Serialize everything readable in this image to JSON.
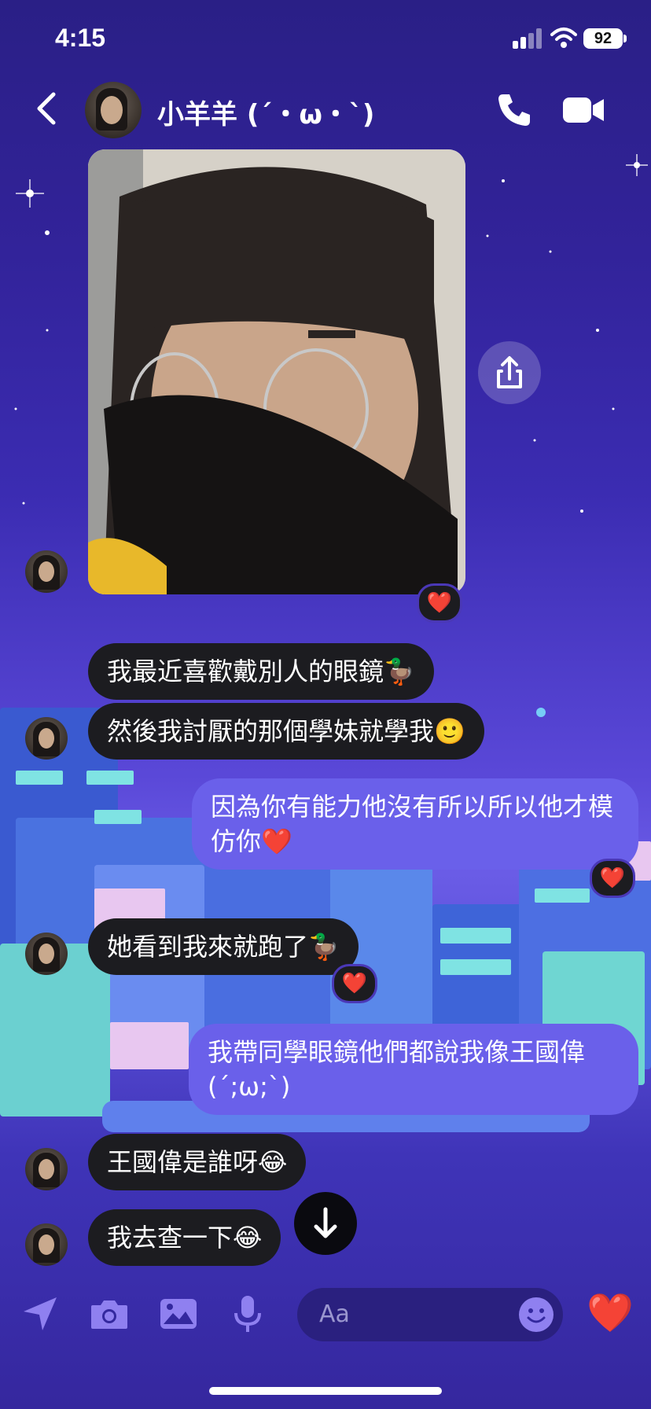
{
  "status_bar": {
    "time": "4:15",
    "battery": "92"
  },
  "header": {
    "contact_name": "小羊羊 (´・ω・`)"
  },
  "messages": [
    {
      "text": "我最近喜歡戴別人的眼鏡🦆"
    },
    {
      "text": "然後我討厭的那個學妹就學我🙂"
    },
    {
      "text": "因為你有能力他沒有所以所以他才模仿你❤️"
    },
    {
      "text": "她看到我來就跑了🦆"
    },
    {
      "text": "我帶同學眼鏡他們都說我像王國偉(´;ω;`)"
    },
    {
      "text": "王國偉是誰呀😂"
    },
    {
      "text": "我去查一下😂"
    }
  ],
  "reactions": {
    "heart": "❤️"
  },
  "composer": {
    "placeholder": "Aa",
    "like": "❤️"
  },
  "colors": {
    "incoming_bubble": "#1c1c20",
    "outgoing_bubble": "#6a60ea",
    "accent": "#8f80f0"
  },
  "icons": [
    "chevron-left-icon",
    "phone-icon",
    "video-icon",
    "share-icon",
    "arrow-down-icon",
    "location-arrow-icon",
    "camera-icon",
    "image-icon",
    "microphone-icon",
    "emoji-icon",
    "heart-icon"
  ]
}
